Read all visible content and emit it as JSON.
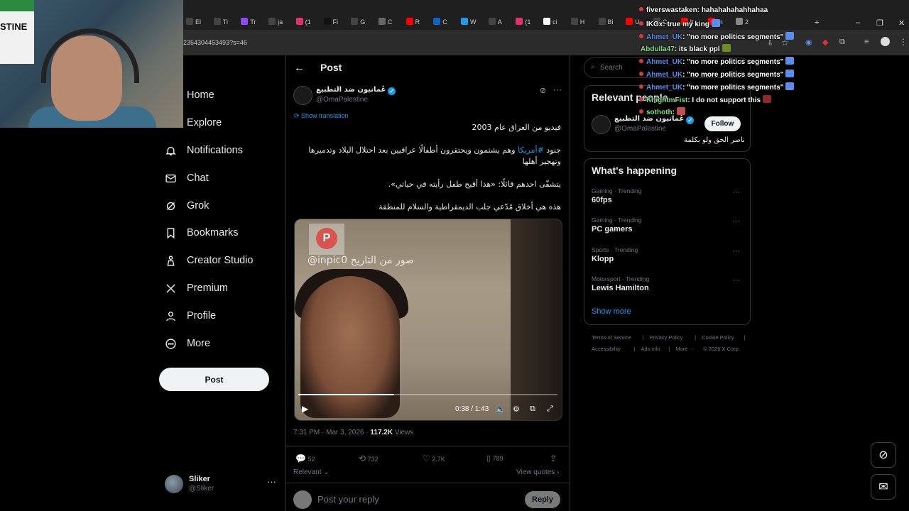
{
  "browser": {
    "tabs": [
      {
        "label": "El",
        "color": "#444"
      },
      {
        "label": "Tr",
        "color": "#444"
      },
      {
        "label": "Tr",
        "color": "#9146ff"
      },
      {
        "label": "ja",
        "color": "#444"
      },
      {
        "label": "(1",
        "color": "#e1306c"
      },
      {
        "label": "Fi",
        "color": "#111"
      },
      {
        "label": "G",
        "color": "#444"
      },
      {
        "label": "C",
        "color": "#666"
      },
      {
        "label": "R",
        "color": "#ff0000"
      },
      {
        "label": "C",
        "color": "#0a66c2"
      },
      {
        "label": "W",
        "color": "#1d9bf0"
      },
      {
        "label": "A",
        "color": "#444"
      },
      {
        "label": "(1",
        "color": "#e1306c"
      },
      {
        "label": "ci",
        "color": "#fff"
      },
      {
        "label": "H",
        "color": "#444"
      },
      {
        "label": "Bi",
        "color": "#444"
      },
      {
        "label": "U",
        "color": "#ff0000"
      },
      {
        "label": "C",
        "color": "#444"
      },
      {
        "label": "It",
        "color": "#ff0000"
      },
      {
        "label": "In",
        "color": "#ff0000"
      },
      {
        "label": "2",
        "color": "#888"
      }
    ],
    "url": "2354304453493?s=46"
  },
  "webcam": {
    "flag_text": "STINE"
  },
  "nav": {
    "items": [
      {
        "label": "Home",
        "icon": "home-icon"
      },
      {
        "label": "Explore",
        "icon": "explore-icon"
      },
      {
        "label": "Notifications",
        "icon": "bell-icon"
      },
      {
        "label": "Chat",
        "icon": "mail-icon"
      },
      {
        "label": "Grok",
        "icon": "grok-icon"
      },
      {
        "label": "Bookmarks",
        "icon": "bookmark-icon"
      },
      {
        "label": "Creator Studio",
        "icon": "creator-icon"
      },
      {
        "label": "Premium",
        "icon": "x-icon"
      },
      {
        "label": "Profile",
        "icon": "person-icon"
      },
      {
        "label": "More",
        "icon": "more-icon"
      }
    ],
    "post_label": "Post",
    "account": {
      "name": "Sliker",
      "handle": "@Sliker"
    }
  },
  "post": {
    "header_title": "Post",
    "author_name": "عُمانيون ضد التطبيع",
    "author_handle": "@OmaPalestine",
    "show_translation": "Show translation",
    "line1": "فيديو من العراق  عام 2003",
    "line2a": "جنود ",
    "line2_tag": "#أمريكا",
    "line2b": " وهم يشتمون ويحتقرون أطفالًا عراقيين بعد احتلال البلاد وتدميرها وتهجير أهلها",
    "line3": "يتشفّى احدهم قائلًا: «هذا أقبح طفل رأيته في حياتي».",
    "line4": "هذه هي أخلاق مُدّعي جلب الديمقراطية والسلام للمنطقة",
    "video": {
      "watermark": "@inpic0  صور من التاريخ",
      "time": "0:38 / 1:43",
      "progress": 0.37
    },
    "meta_time": "7:31 PM · Mar 3, 2026 · ",
    "views_count": "117.2K",
    "views_label": " Views",
    "stats": {
      "replies": "52",
      "reposts": "732",
      "likes": "2.7K",
      "bookmarks": "789"
    },
    "relevant": "Relevant",
    "view_quotes": "View quotes",
    "reply_placeholder": "Post your reply",
    "reply_btn": "Reply"
  },
  "sidebar": {
    "search_placeholder": "Search",
    "relevant_title": "Relevant people",
    "rel_name": "عُمانيون ضد التطبيع",
    "rel_handle": "@OmaPalestine",
    "follow": "Follow",
    "rel_bio": "ناصر الحق ولو بكلمة",
    "happening_title": "What's happening",
    "trends": [
      {
        "cat": "Gaming · Trending",
        "name": "60fps"
      },
      {
        "cat": "Gaming · Trending",
        "name": "PC gamers"
      },
      {
        "cat": "Sports · Trending",
        "name": "Klopp"
      },
      {
        "cat": "Motorsport · Trending",
        "name": "Lewis Hamilton"
      }
    ],
    "show_more": "Show more",
    "footer": [
      "Terms of Service",
      "|",
      "Privacy Policy",
      "|",
      "Cookie Policy",
      "|",
      "Accessibility",
      "|",
      "Ads info",
      "|",
      "More ···",
      "© 2026 X Corp."
    ]
  },
  "chat": [
    {
      "user": "fiverswastaken",
      "msg": ": hahahahahahhahaa",
      "color": "#ffffff"
    },
    {
      "user": "IKGx",
      "msg": ": true my king",
      "color": "#ffffff"
    },
    {
      "user": "Ahmet_UK",
      "msg": ": \"no more politics segments\"",
      "color": "#5b8def"
    },
    {
      "user": "Abdulla47",
      "msg": ": its black ppl",
      "color": "#7fe07f"
    },
    {
      "user": "Ahmet_UK",
      "msg": ": \"no more politics segments\"",
      "color": "#5b8def"
    },
    {
      "user": "Ahmet_UK",
      "msg": ": \"no more politics segments\"",
      "color": "#5b8def"
    },
    {
      "user": "Ahmet_UK",
      "msg": ": \"no more politics segments\"",
      "color": "#5b8def"
    },
    {
      "user": "KnightmFist",
      "msg": ": I do not support this",
      "color": "#7fe07f"
    },
    {
      "user": "sothoth",
      "msg": ":",
      "color": "#7fe07f"
    }
  ]
}
